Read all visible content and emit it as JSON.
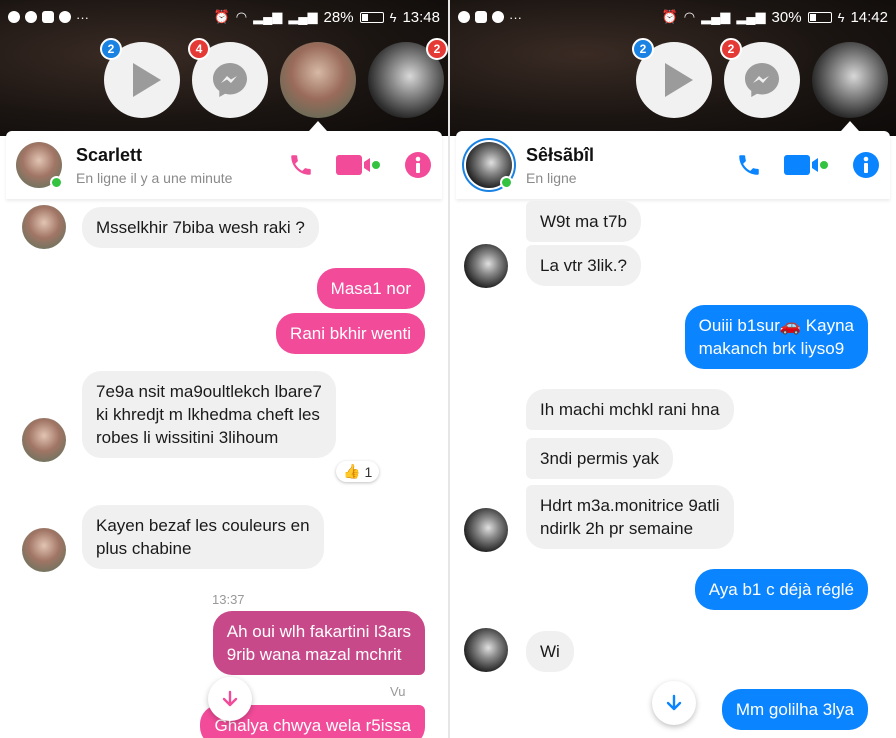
{
  "left": {
    "status_bar": {
      "battery": "28%",
      "battery_fill": 0.28,
      "time": "13:48",
      "overflow": "···"
    },
    "chat_heads": [
      {
        "type": "video",
        "badge": "2"
      },
      {
        "type": "messenger",
        "badge": "4"
      },
      {
        "type": "contact"
      },
      {
        "type": "contact",
        "badge": "2"
      }
    ],
    "header": {
      "name": "Scarlett",
      "status": "En ligne il y a une minute"
    },
    "messages": [
      {
        "dir": "in",
        "text": "Msselkhir 7biba wesh raki ?"
      },
      {
        "dir": "out",
        "text": "Masa1 nor"
      },
      {
        "dir": "out",
        "text": "Rani bkhir wenti"
      },
      {
        "dir": "in",
        "lines": [
          "7e9a nsit ma9oultlekch lbare7",
          "ki khredjt m lkhedma cheft les",
          "robes li wissitini 3lihoum"
        ]
      },
      {
        "dir": "in",
        "lines": [
          "Kayen bezaf les couleurs en",
          "plus chabine"
        ]
      },
      {
        "dir": "out",
        "lines": [
          "Ah oui wlh fakartini l3ars",
          "9rib wana mazal mchrit"
        ]
      },
      {
        "dir": "out",
        "text": "Ghalya chwya wela r5issa"
      }
    ],
    "reaction": {
      "emoji": "👍",
      "count": "1"
    },
    "timestamp": "13:37",
    "seen": "Vu"
  },
  "right": {
    "status_bar": {
      "battery": "30%",
      "battery_fill": 0.3,
      "time": "14:42",
      "overflow": "···"
    },
    "chat_heads": [
      {
        "type": "video",
        "badge": "2"
      },
      {
        "type": "messenger",
        "badge": "2"
      },
      {
        "type": "contact"
      }
    ],
    "header": {
      "name": "Sêłsãbîl",
      "status": "En ligne"
    },
    "messages": [
      {
        "dir": "in",
        "text": "W9t ma t7b"
      },
      {
        "dir": "in",
        "text": "La vtr 3lik.?"
      },
      {
        "dir": "out",
        "lines": [
          "Ouiii b1sur🚗 Kayna",
          "makanch brk liyso9"
        ]
      },
      {
        "dir": "in",
        "text": "Ih machi mchkl rani hna"
      },
      {
        "dir": "in",
        "text": "3ndi permis yak"
      },
      {
        "dir": "in",
        "lines": [
          "Hdrt m3a.monitrice 9atli",
          "ndirlk 2h pr semaine"
        ]
      },
      {
        "dir": "out",
        "text": "Aya b1 c déjà réglé"
      },
      {
        "dir": "in",
        "text": "Wi"
      },
      {
        "dir": "out",
        "text": "Mm golilha 3lya"
      }
    ]
  },
  "colors": {
    "left_accent": "#f24b99",
    "right_accent": "#0a84ff",
    "online": "#33c341",
    "incoming_bubble": "#f1f0f0"
  },
  "icons": [
    "play-icon",
    "messenger-icon",
    "phone-icon",
    "video-icon",
    "info-icon",
    "arrow-down-icon",
    "thumbs-up-icon"
  ]
}
